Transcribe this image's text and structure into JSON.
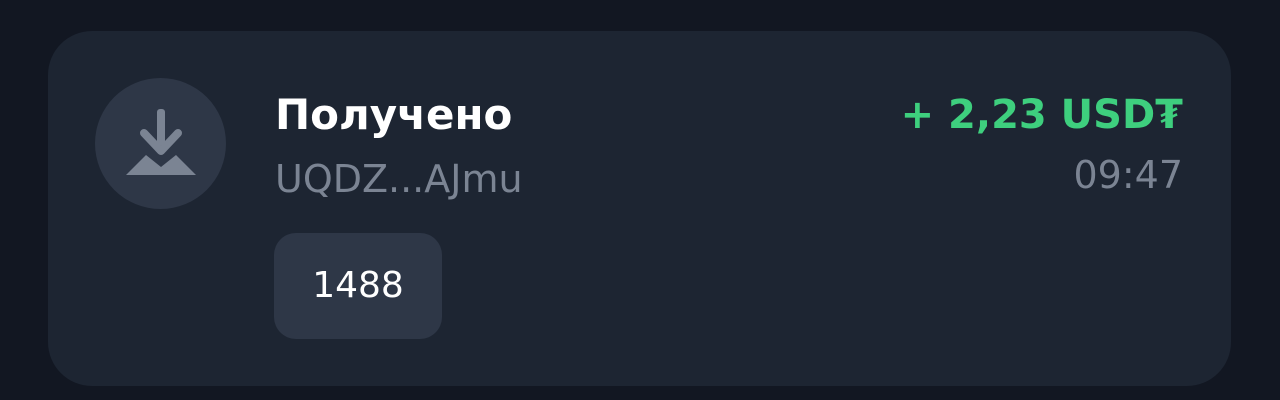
{
  "transaction": {
    "icon": "download-icon",
    "status": "Получено",
    "address": "UQDZ...AJmu",
    "amount": "+ 2,23 USD₮",
    "time": "09:47",
    "comment": "1488"
  },
  "colors": {
    "background": "#121722",
    "card": "#1d2532",
    "icon_bg": "#2e3747",
    "icon_fg": "#7b8493",
    "amount_positive": "#3ecf7e",
    "muted_text": "#7b8493",
    "primary_text": "#ffffff"
  }
}
